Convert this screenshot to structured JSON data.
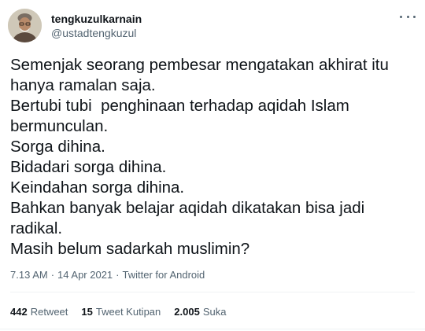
{
  "user": {
    "display_name": "tengkuzulkarnain",
    "handle": "@ustadtengkuzul"
  },
  "more_icon": "more-horizontal-icon",
  "tweet_text": "Semenjak seorang pembesar mengatakan akhirat itu\nhanya ramalan saja.\nBertubi tubi  penghinaan terhadap aqidah Islam\nbermunculan.\nSorga dihina.\nBidadari sorga dihina.\nKeindahan sorga dihina.\nBahkan banyak belajar aqidah dikatakan bisa jadi\nradikal.\nMasih belum sadarkah muslimin?",
  "meta": {
    "time": "7.13 AM",
    "date": "14 Apr 2021",
    "source": "Twitter for Android",
    "separator": "·"
  },
  "stats": {
    "retweets": {
      "count": "442",
      "label": "Retweet"
    },
    "quotes": {
      "count": "15",
      "label": "Tweet Kutipan"
    },
    "likes": {
      "count": "2.005",
      "label": "Suka"
    }
  }
}
